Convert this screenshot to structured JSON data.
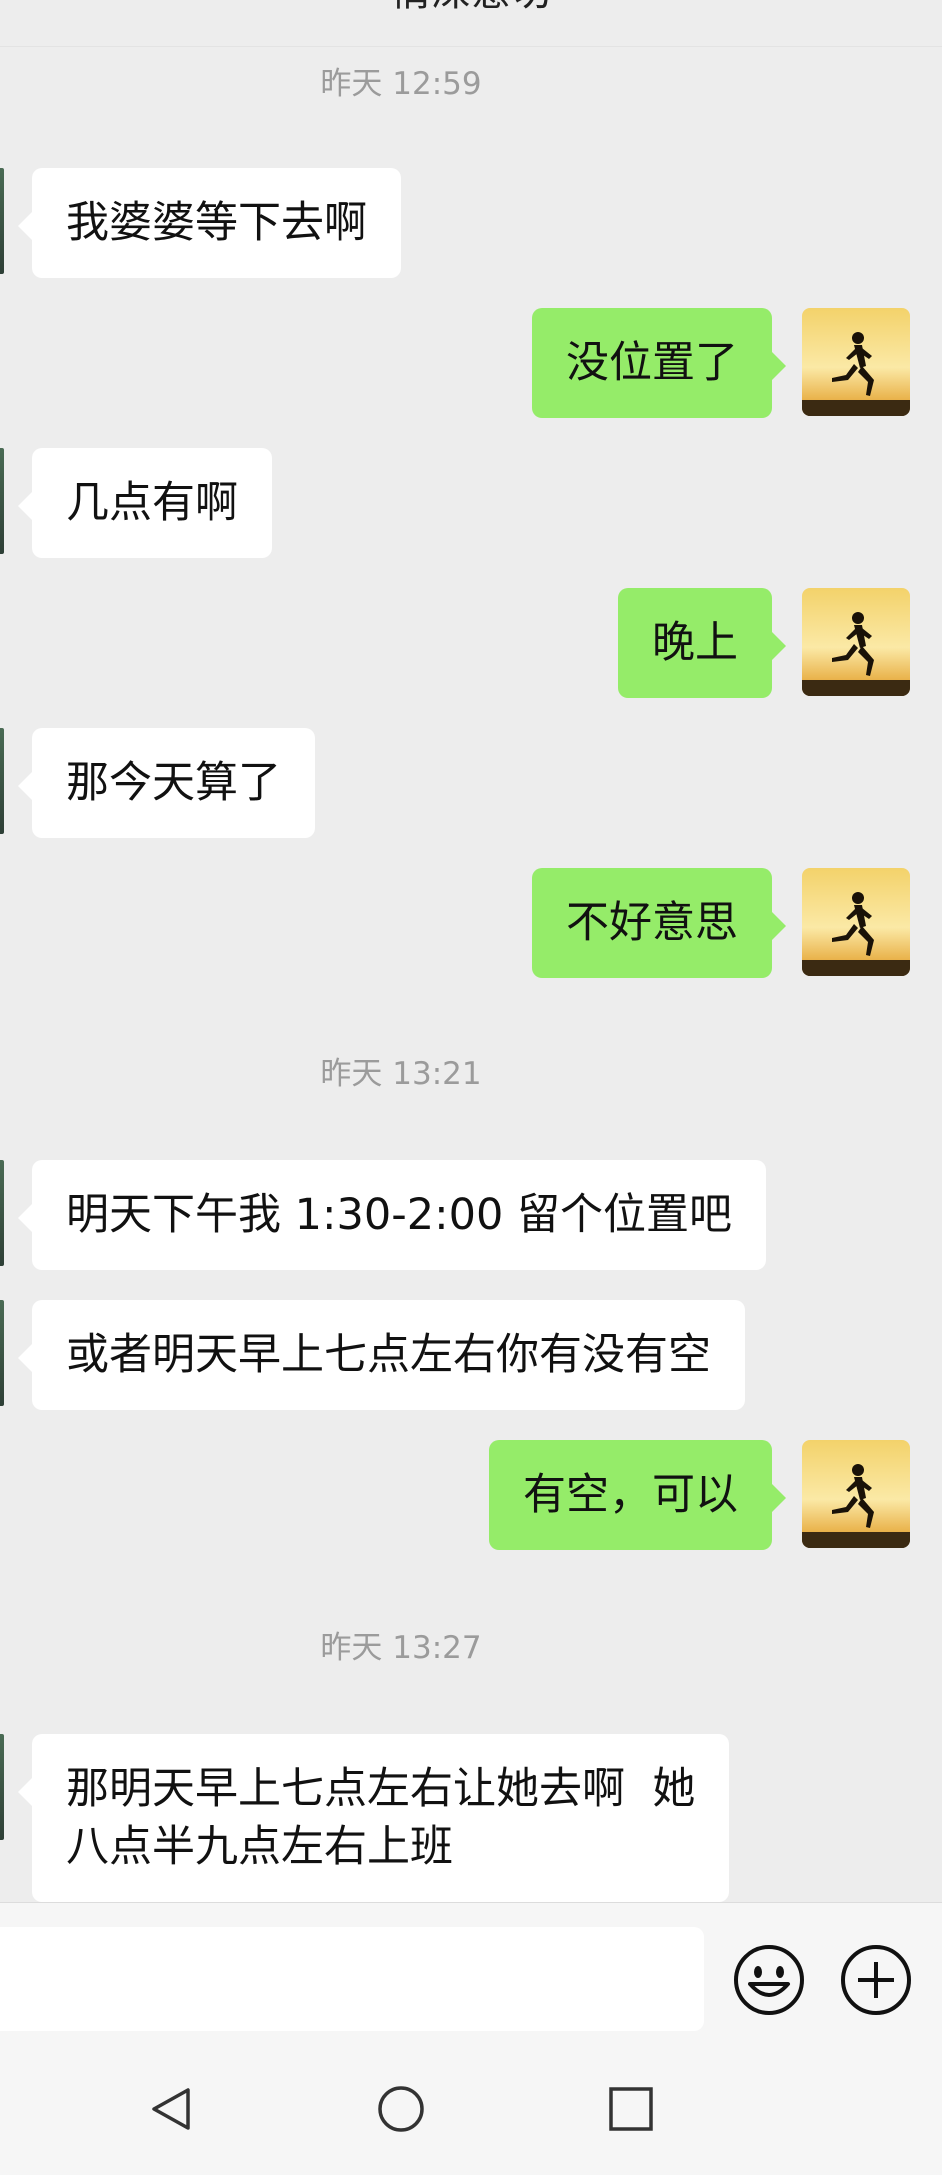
{
  "header": {
    "title": "情深意切"
  },
  "timestamps": [
    "昨天 12:59",
    "昨天 13:21",
    "昨天 13:27"
  ],
  "messages": [
    {
      "side": "in",
      "text": "我婆婆等下去啊"
    },
    {
      "side": "out",
      "text": "没位置了"
    },
    {
      "side": "in",
      "text": "几点有啊"
    },
    {
      "side": "out",
      "text": "晚上"
    },
    {
      "side": "in",
      "text": "那今天算了"
    },
    {
      "side": "out",
      "text": "不好意思"
    },
    {
      "side": "in",
      "text": "明天下午我 1:30-2:00 留个位置吧"
    },
    {
      "side": "in",
      "text": "或者明天早上七点左右你有没有空"
    },
    {
      "side": "out",
      "text": "有空，可以"
    },
    {
      "side": "in",
      "text": "那明天早上七点左右让她去啊  她\n八点半九点左右上班"
    }
  ],
  "input": {
    "value": "",
    "emoji_icon": "smiley-face-icon",
    "plus_icon": "plus-circle-icon"
  },
  "nav": {
    "back_icon": "triangle-back-icon",
    "home_icon": "circle-home-icon",
    "recents_icon": "square-recents-icon"
  },
  "colors": {
    "background": "#ededed",
    "outgoing_bubble": "#95ec69",
    "incoming_bubble": "#ffffff",
    "timestamp_text": "#9b9b9b"
  }
}
